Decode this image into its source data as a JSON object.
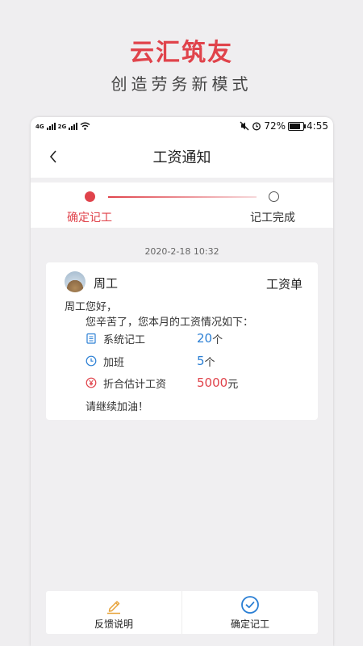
{
  "promo": {
    "title": "云汇筑友",
    "subtitle": "创造劳务新模式"
  },
  "status_bar": {
    "network_1": "4G",
    "network_2": "2G",
    "battery_percent": "72%",
    "time": "4:55"
  },
  "header": {
    "title": "工资通知"
  },
  "steps": [
    {
      "label": "确定记工",
      "state": "active"
    },
    {
      "label": "记工完成",
      "state": "pending"
    }
  ],
  "message": {
    "timestamp": "2020-2-18   10:32",
    "sender": "周工",
    "type": "工资单",
    "greeting": "周工您好，",
    "intro": "您辛苦了，您本月的工资情况如下：",
    "rows": [
      {
        "icon": "clipboard-icon",
        "label": "系统记工",
        "value": "20",
        "unit": "个"
      },
      {
        "icon": "clock-icon",
        "label": "加班",
        "value": "5",
        "unit": "个"
      },
      {
        "icon": "yen-icon",
        "label": "折合估计工资",
        "value": "5000",
        "unit": "元"
      }
    ],
    "closing": "请继续加油！"
  },
  "actions": {
    "feedback_label": "反馈说明",
    "confirm_label": "确定记工"
  },
  "colors": {
    "accent": "#e0434b",
    "blue": "#2b7fd4",
    "feedback_icon": "#e7a33a"
  }
}
